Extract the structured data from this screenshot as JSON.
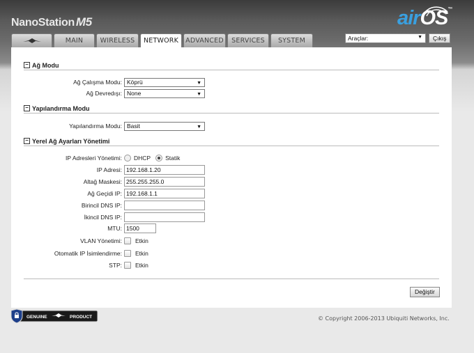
{
  "header": {
    "product_name": "NanoStation",
    "model": "M5",
    "logo_air": "air",
    "logo_os": "OS",
    "logo_tm": "™"
  },
  "tools": {
    "select_value": "Araçlar:",
    "logout_label": "Çıkış"
  },
  "tabs": [
    {
      "label": "",
      "icon": "ubiquiti-logo-icon"
    },
    {
      "label": "MAIN"
    },
    {
      "label": "WIRELESS"
    },
    {
      "label": "NETWORK",
      "active": true
    },
    {
      "label": "ADVANCED"
    },
    {
      "label": "SERVICES"
    },
    {
      "label": "SYSTEM"
    }
  ],
  "network_mode": {
    "title": "Ağ Modu",
    "mode_label": "Ağ Çalışma Modu:",
    "mode_value": "Köprü",
    "disabled_label": "Ağ Devredışı:",
    "disabled_value": "None"
  },
  "config_mode": {
    "title": "Yapılandırma Modu",
    "label": "Yapılandırma Modu:",
    "value": "Basit"
  },
  "lan": {
    "title": "Yerel Ağ Ayarları Yönetimi",
    "ip_mgmt_label": "IP Adresleri Yönetimi:",
    "dhcp_label": "DHCP",
    "static_label": "Statik",
    "ip_label": "IP Adresi:",
    "ip_value": "192.168.1.20",
    "netmask_label": "Altağ Maskesi:",
    "netmask_value": "255.255.255.0",
    "gateway_label": "Ağ Geçidi IP:",
    "gateway_value": "192.168.1.1",
    "dns1_label": "Birincil DNS IP:",
    "dns1_value": "",
    "dns2_label": "İkincil DNS IP:",
    "dns2_value": "",
    "mtu_label": "MTU:",
    "mtu_value": "1500",
    "vlan_label": "VLAN Yönetimi:",
    "vlan_enable": "Etkin",
    "auto_ip_label": "Otomatik IP İsimlendirme:",
    "auto_ip_enable": "Etkin",
    "stp_label": "STP:",
    "stp_enable": "Etkin"
  },
  "footer": {
    "apply_label": "Değiştir",
    "genuine_text": "GENUINE",
    "product_text": "PRODUCT",
    "copyright": "© Copyright 2006-2013 Ubiquiti Networks, Inc."
  }
}
